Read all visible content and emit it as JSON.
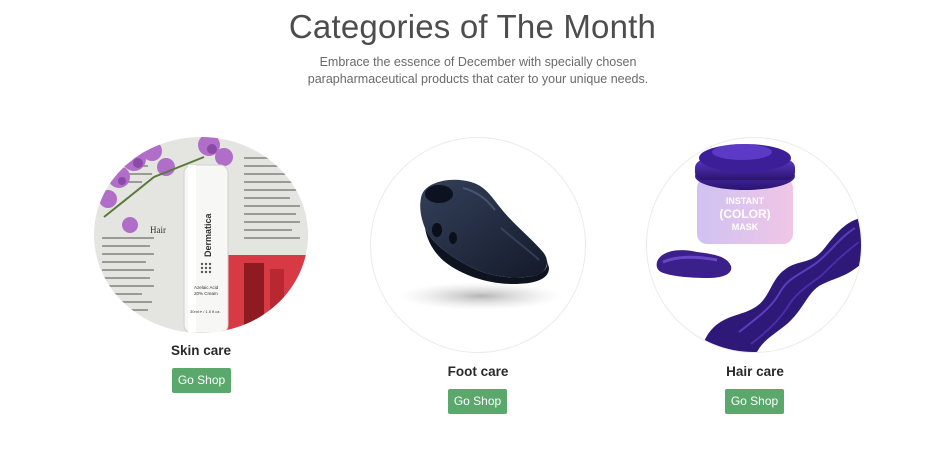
{
  "header": {
    "title": "Categories of The Month",
    "subtitle": "Embrace the essence of December with specially chosen parapharmaceutical products that cater to your unique needs."
  },
  "categories": [
    {
      "name": "Skin care",
      "button_label": "Go Shop",
      "image_icon": "skin-care-product-image",
      "product_text": {
        "brand": "Dermatica",
        "product_line1": "Azelaic Acid",
        "product_line2": "20% Cream",
        "volume": "30ml ℮ / 1.0 fl.oz."
      }
    },
    {
      "name": "Foot care",
      "button_label": "Go Shop",
      "image_icon": "clog-shoe-image"
    },
    {
      "name": "Hair care",
      "button_label": "Go Shop",
      "image_icon": "hair-color-product-image",
      "product_text": {
        "label_top": "INSTANT",
        "label_main": "(COLOR)",
        "label_bottom": "MASK"
      }
    }
  ],
  "colors": {
    "button_bg": "#5aa86c",
    "button_text": "#ffffff",
    "title_text": "#4d4d4d",
    "hair_purple": "#3b1f8a"
  }
}
